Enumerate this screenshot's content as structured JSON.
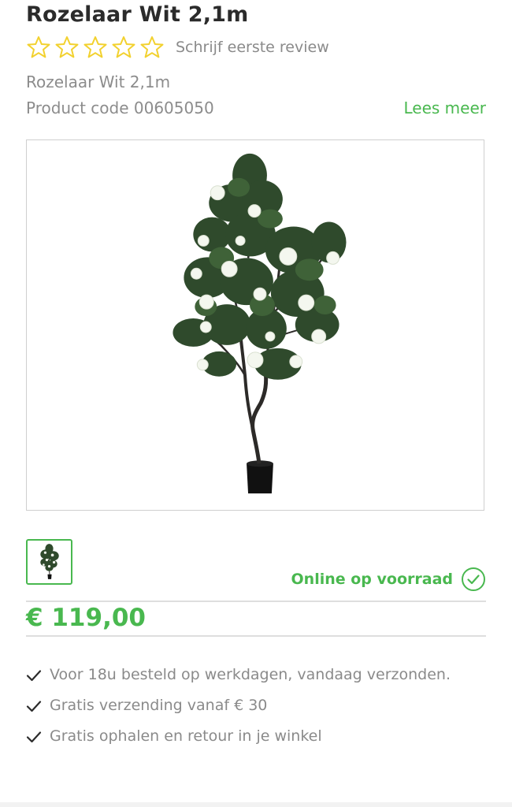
{
  "product": {
    "title": "Rozelaar Wit 2,1m",
    "subtitle": "Rozelaar Wit 2,1m",
    "code_text": "Product code 00605050",
    "read_more": "Lees meer"
  },
  "rating": {
    "stars_filled": 0,
    "stars_total": 5,
    "review_link": "Schrijf eerste review",
    "star_color": "#f2d12e"
  },
  "stock": {
    "label": "Online op voorraad",
    "icon": "check-circle-icon"
  },
  "price": {
    "value": "€ 119,00"
  },
  "usps": [
    {
      "icon": "check-icon",
      "text": "Voor 18u besteld op werkdagen, vandaag verzonden."
    },
    {
      "icon": "check-icon",
      "text": "Gratis verzending vanaf € 30"
    },
    {
      "icon": "check-icon",
      "text": "Gratis ophalen en retour in je winkel"
    }
  ],
  "colors": {
    "accent_green": "#49b84f",
    "text_grey": "#8a8a8a",
    "title_dark": "#2b2b2b"
  }
}
